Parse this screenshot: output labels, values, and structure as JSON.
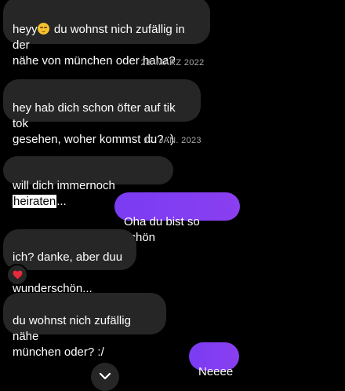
{
  "messages": [
    {
      "pre_emoji": "heyy",
      "emoji_icon": "relieved-face-emoji",
      "text": " du wohnst nich zufällig in der\nnähe von münchen oder haha?"
    },
    {
      "text": "hey hab dich schon öfter auf tik tok\ngesehen, woher kommst du? :)"
    },
    {
      "before": "will dich immernoch ",
      "highlight": "heiraten",
      "after": "..."
    },
    {
      "text": "Oha du bist so schön"
    },
    {
      "text": "ich? danke, aber duu -\nwunderschön...",
      "reaction": "❤️"
    },
    {
      "text": "du wohnst nich zufällig nähe\nmünchen oder? :/"
    },
    {
      "text": "Neeee"
    }
  ],
  "dates": [
    "28. MÄRZ 2022",
    "17. JAN. 2023"
  ],
  "colors": {
    "received_bubble": "#262626",
    "sent_bubble": "#7c3aed",
    "background": "#000000",
    "reaction_heart": "#e8293b"
  }
}
